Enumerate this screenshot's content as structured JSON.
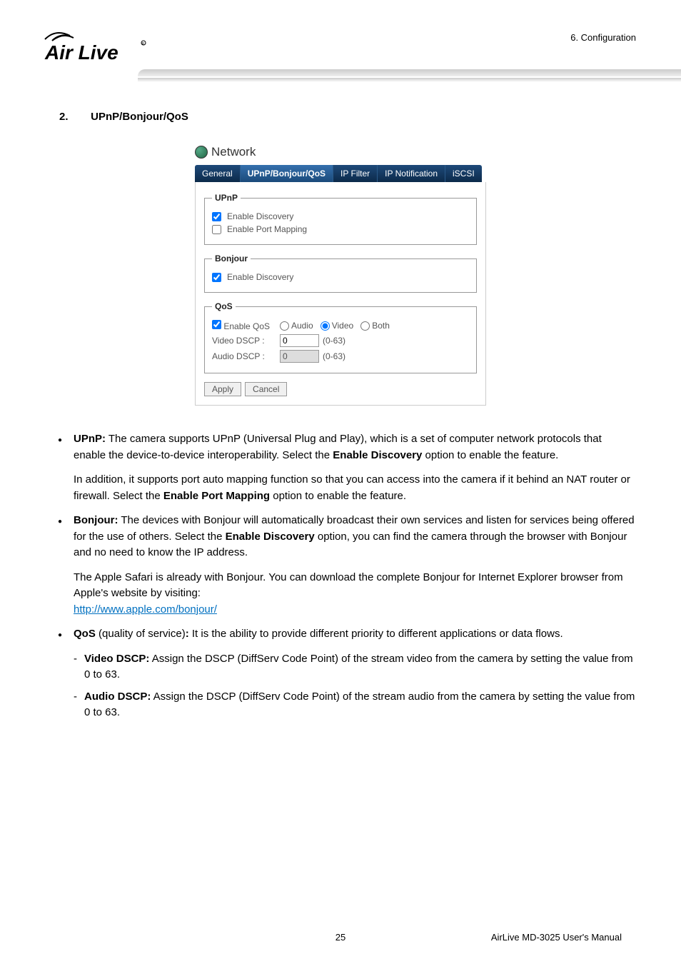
{
  "header": {
    "breadcrumb": "6. Configuration",
    "logo_alt": "Air Live"
  },
  "section": {
    "number": "2.",
    "title": "UPnP/Bonjour/QoS"
  },
  "screenshot": {
    "title": "Network",
    "tabs": {
      "general": "General",
      "upnp": "UPnP/Bonjour/QoS",
      "ipfilter": "IP Filter",
      "ipnotif": "IP Notification",
      "iscsi": "iSCSI"
    },
    "upnp_legend": "UPnP",
    "upnp_discovery": "Enable Discovery",
    "upnp_portmap": "Enable Port Mapping",
    "bonjour_legend": "Bonjour",
    "bonjour_discovery": "Enable Discovery",
    "qos_legend": "QoS",
    "enable_qos": "Enable QoS",
    "audio_radio": "Audio",
    "video_radio": "Video",
    "both_radio": "Both",
    "video_dscp_label": "Video DSCP :",
    "video_dscp_value": "0",
    "video_dscp_range": "(0-63)",
    "audio_dscp_label": "Audio DSCP :",
    "audio_dscp_value": "0",
    "audio_dscp_range": "(0-63)",
    "apply": "Apply",
    "cancel": "Cancel"
  },
  "body": {
    "upnp_bold": "UPnP:",
    "upnp_text1": " The camera supports UPnP (Universal Plug and Play), which is a set of computer network protocols that enable the device-to-device interoperability. Select the ",
    "upnp_ed_bold": "Enable Discovery",
    "upnp_text2": " option to enable the feature.",
    "upnp_para2a": "In addition, it supports port auto mapping function so that you can access into the camera if it behind an NAT router or firewall. Select the ",
    "upnp_epm_bold": "Enable Port Mapping",
    "upnp_para2b": " option to enable the feature.",
    "bonjour_bold": "Bonjour:",
    "bonjour_text1": " The devices with Bonjour will automatically broadcast their own services and listen for services being offered for the use of others. Select the ",
    "bonjour_ed_bold": "Enable Discovery",
    "bonjour_text2": " option, you can find the camera through the browser with Bonjour and no need to know the IP address.",
    "bonjour_para2": "The Apple Safari is already with Bonjour. You can download the complete Bonjour for Internet Explorer browser from Apple's website by visiting:",
    "bonjour_link": "http://www.apple.com/bonjour/",
    "qos_bold": "QoS",
    "qos_paren": " (quality of service)",
    "qos_colon": ":",
    "qos_text": " It is the ability to provide different priority to different applications or data flows.",
    "video_dscp_bold": "Video DSCP:",
    "video_dscp_text": " Assign the DSCP (DiffServ Code Point) of the stream video from the camera by setting the value from 0 to 63.",
    "audio_dscp_bold": "Audio DSCP:",
    "audio_dscp_text": " Assign the DSCP (DiffServ Code Point) of the stream audio from the camera by setting the value from 0 to 63."
  },
  "footer": {
    "page": "25",
    "manual": "AirLive MD-3025  User's Manual"
  }
}
